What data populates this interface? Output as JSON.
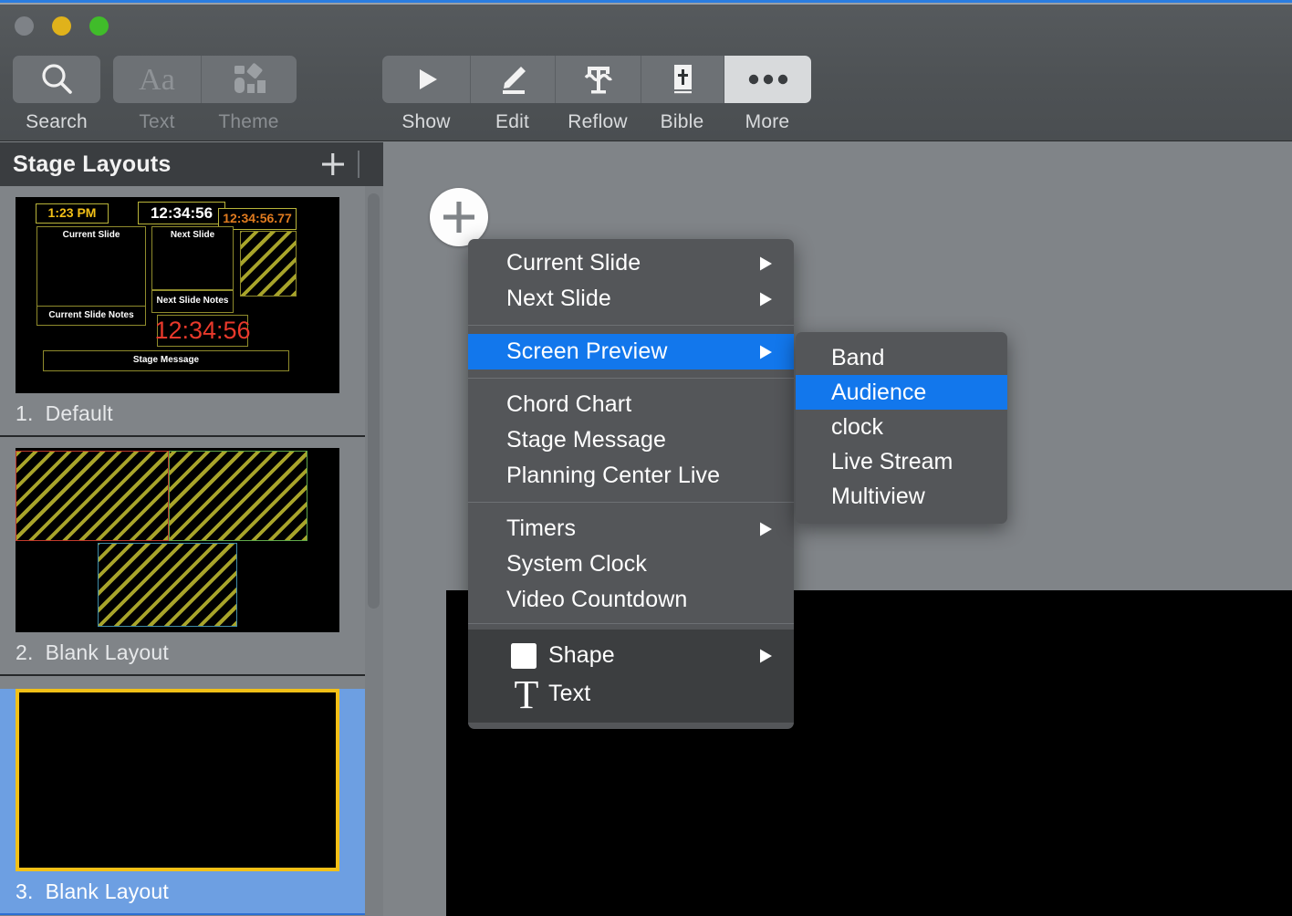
{
  "window": {
    "traffic_lights": [
      "close",
      "minimize",
      "maximize"
    ]
  },
  "toolbar": {
    "left_group": [
      {
        "label": "Search",
        "icon": "search-icon",
        "state": "enabled"
      },
      {
        "label": "Text",
        "icon": "text-format-icon",
        "state": "disabled"
      },
      {
        "label": "Theme",
        "icon": "theme-icon",
        "state": "disabled"
      }
    ],
    "right_group": [
      {
        "label": "Show",
        "icon": "play-icon",
        "state": "enabled"
      },
      {
        "label": "Edit",
        "icon": "pencil-icon",
        "state": "enabled"
      },
      {
        "label": "Reflow",
        "icon": "reflow-text-icon",
        "state": "enabled"
      },
      {
        "label": "Bible",
        "icon": "bible-icon",
        "state": "enabled"
      },
      {
        "label": "More",
        "icon": "ellipsis-icon",
        "state": "active"
      }
    ]
  },
  "sidebar": {
    "title": "Stage Layouts",
    "add_label": "+",
    "layouts": [
      {
        "number": "1.",
        "name": "Default",
        "selected": false,
        "zones": [
          {
            "label": "1:23 PM",
            "kind": "clock-yellow"
          },
          {
            "label": "12:34:56",
            "kind": "clock-white"
          },
          {
            "label": "12:34:56.77",
            "kind": "clock-orange"
          },
          {
            "label": "Current Slide",
            "kind": "slide"
          },
          {
            "label": "Next Slide",
            "kind": "slide"
          },
          {
            "label": "Next Slide Notes",
            "kind": "notes"
          },
          {
            "label": "Current Slide Notes",
            "kind": "notes"
          },
          {
            "label": "12:34:56",
            "kind": "timer-red"
          },
          {
            "label": "Stage Message",
            "kind": "message"
          },
          {
            "label": "",
            "kind": "hatched"
          }
        ]
      },
      {
        "number": "2.",
        "name": "Blank Layout",
        "selected": false,
        "zones": [
          {
            "label": "",
            "kind": "hatched",
            "border": "#c0392b"
          },
          {
            "label": "",
            "kind": "hatched",
            "border": "#5fa84a"
          },
          {
            "label": "",
            "kind": "hatched",
            "border": "#3f8ca8"
          }
        ]
      },
      {
        "number": "3.",
        "name": "Blank Layout",
        "selected": true,
        "zones": [
          {
            "label": "",
            "kind": "empty",
            "border": "#f2c017"
          }
        ]
      }
    ]
  },
  "canvas": {
    "add_button_label": "add-element"
  },
  "context_menu": {
    "groups": [
      {
        "items": [
          {
            "label": "Current Slide",
            "submenu": true,
            "highlighted": false
          },
          {
            "label": "Next Slide",
            "submenu": true,
            "highlighted": false
          }
        ]
      },
      {
        "items": [
          {
            "label": "Screen Preview",
            "submenu": true,
            "highlighted": true
          }
        ]
      },
      {
        "items": [
          {
            "label": "Chord Chart",
            "submenu": false,
            "highlighted": false
          },
          {
            "label": "Stage Message",
            "submenu": false,
            "highlighted": false
          },
          {
            "label": "Planning Center Live",
            "submenu": false,
            "highlighted": false
          }
        ]
      },
      {
        "items": [
          {
            "label": "Timers",
            "submenu": true,
            "highlighted": false
          },
          {
            "label": "System Clock",
            "submenu": false,
            "highlighted": false
          },
          {
            "label": "Video Countdown",
            "submenu": false,
            "highlighted": false
          }
        ]
      },
      {
        "lower": true,
        "items": [
          {
            "label": "Shape",
            "submenu": true,
            "highlighted": false,
            "icon": "square-icon"
          },
          {
            "label": "Text",
            "submenu": false,
            "highlighted": false,
            "icon": "text-T-icon"
          }
        ]
      }
    ]
  },
  "submenu": {
    "parent": "Screen Preview",
    "items": [
      {
        "label": "Band",
        "highlighted": false
      },
      {
        "label": "Audience",
        "highlighted": true
      },
      {
        "label": "clock",
        "highlighted": false
      },
      {
        "label": "Live Stream",
        "highlighted": false
      },
      {
        "label": "Multiview",
        "highlighted": false
      }
    ]
  },
  "colors": {
    "accent_blue": "#1277ec",
    "selection_blue": "#6d9fe2",
    "menu_bg": "#545659",
    "menu_lower_bg": "#3c3e40",
    "toolbar_bg": "#4e5255",
    "sidebar_bg": "#808488",
    "hatch_yellow": "#a8a42a",
    "clock_yellow": "#f2c017",
    "timer_red": "#e8392b",
    "clock_orange": "#e07b1f"
  }
}
